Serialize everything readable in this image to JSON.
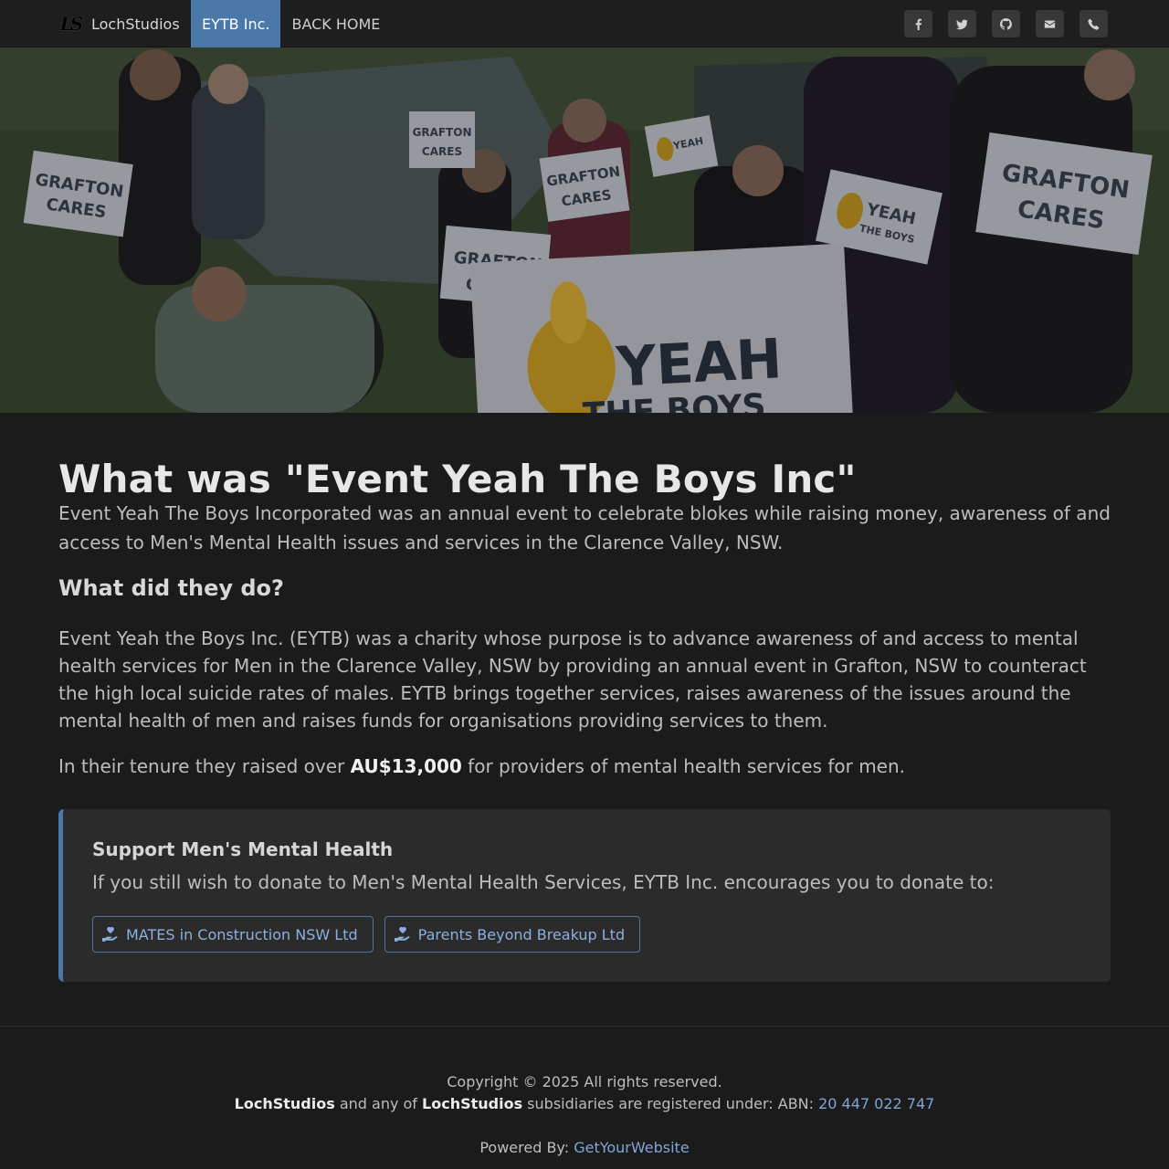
{
  "nav": {
    "brand_logo": "LS",
    "brand_name": "LochStudios",
    "links": [
      {
        "label": "EYTB Inc.",
        "active": true
      },
      {
        "label": "BACK HOME",
        "active": false
      }
    ],
    "social_icons": [
      "facebook-icon",
      "twitter-icon",
      "github-icon",
      "email-icon",
      "phone-icon"
    ]
  },
  "hero": {
    "sign_grafton": "GRAFTON",
    "sign_cares": "CARES",
    "sign_yeah": "YEAH",
    "sign_the_boys": "THE BOYS"
  },
  "main": {
    "title": "What was \"Event Yeah The Boys Inc\"",
    "lead": "Event Yeah The Boys Incorporated was an annual event to celebrate blokes while raising money, awareness of and access to Men's Mental Health issues and services in the Clarence Valley, NSW.",
    "subtitle": "What did they do?",
    "paragraph": "Event Yeah the Boys Inc. (EYTB) was a charity whose purpose is to advance awareness of and access to mental health services for Men in the Clarence Valley, NSW by providing an annual event in Grafton, NSW to counteract the high local suicide rates of males. EYTB brings together services, raises awareness of the issues around the mental health of men and raises funds for organisations providing services to them.",
    "raised_prefix": "In their tenure they raised over ",
    "raised_amount": "AU$13,000",
    "raised_suffix": " for providers of mental health services for men."
  },
  "callout": {
    "heading": "Support Men's Mental Health",
    "text": "If you still wish to donate to Men's Mental Health Services, EYTB Inc. encourages you to donate to:",
    "buttons": [
      {
        "label": "MATES in Construction NSW Ltd",
        "icon": "donate-hand-icon"
      },
      {
        "label": "Parents Beyond Breakup Ltd",
        "icon": "donate-hand-icon"
      }
    ]
  },
  "footer": {
    "copyright": "Copyright © 2025 All rights reserved.",
    "company": "LochStudios",
    "mid_text": " and any of ",
    "company2": "LochStudios",
    "abn_text": " subsidiaries are registered under: ABN: ",
    "abn": "20 447 022 747",
    "powered_label": "Powered By: ",
    "powered_link": "GetYourWebsite"
  },
  "colors": {
    "accent": "#4a78a9",
    "link": "#7fa6d6",
    "background": "#1b1b1c"
  }
}
